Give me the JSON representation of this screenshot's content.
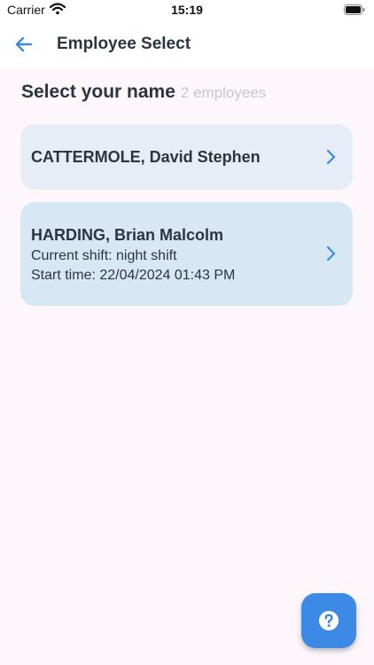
{
  "status_bar": {
    "carrier": "Carrier",
    "time": "15:19"
  },
  "app_bar": {
    "title": "Employee Select",
    "back_icon": "arrow-left-icon"
  },
  "heading": {
    "title": "Select your name",
    "count": "2 employees"
  },
  "employees": [
    {
      "name": "CATTERMOLE, David Stephen"
    },
    {
      "name": "HARDING, Brian Malcolm",
      "shift": "Current shift: night shift",
      "start": "Start time: 22/04/2024 01:43 PM"
    }
  ],
  "help_fab": {
    "icon": "help-circle-icon"
  },
  "colors": {
    "accent": "#3d8ae6",
    "card_default": "#e7edf6",
    "card_active": "#d7e7f3",
    "background": "#fdf6fb",
    "text": "#2b3540",
    "muted": "#c8c8cc"
  }
}
